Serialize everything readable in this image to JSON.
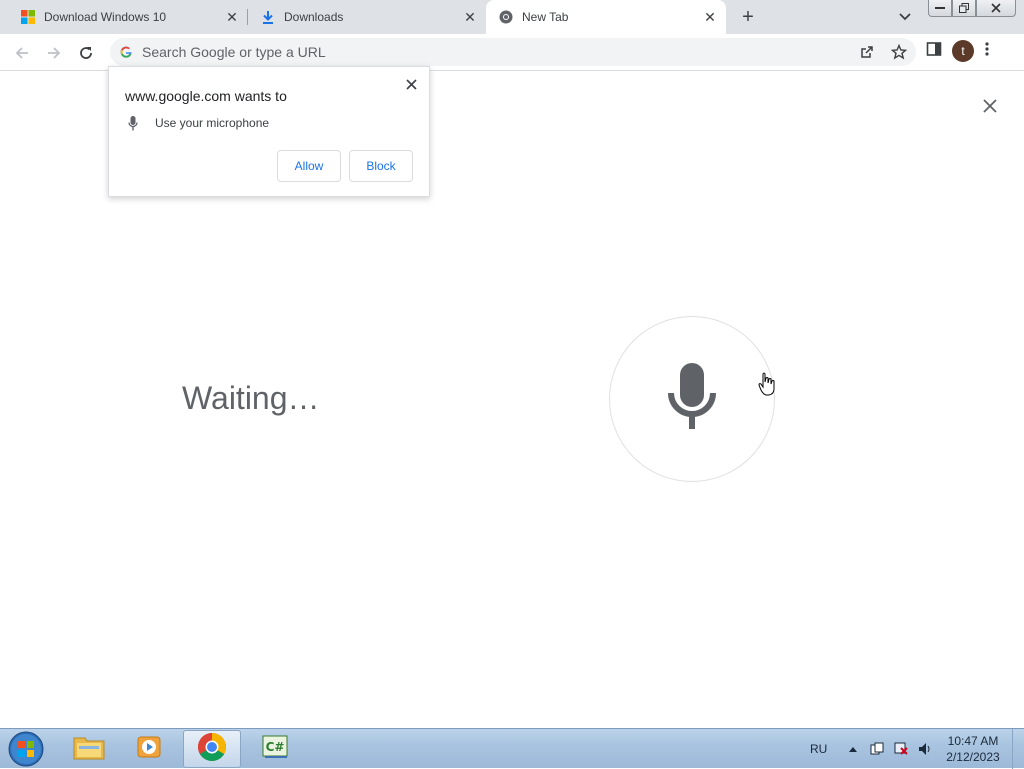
{
  "tabs": [
    {
      "title": "Download Windows 10",
      "icon": "windows-logo-icon"
    },
    {
      "title": "Downloads",
      "icon": "download-icon"
    },
    {
      "title": "New Tab",
      "icon": "chrome-icon",
      "active": true
    }
  ],
  "omnibox": {
    "placeholder": "Search Google or type a URL"
  },
  "profile": {
    "initial": "t"
  },
  "permission_popup": {
    "title": "www.google.com wants to",
    "request": "Use your microphone",
    "allow_label": "Allow",
    "block_label": "Block"
  },
  "voice_search": {
    "status": "Waiting…"
  },
  "taskbar": {
    "language": "RU",
    "time": "10:47 AM",
    "date": "2/12/2023"
  },
  "colors": {
    "accent": "#1a73e8",
    "tabstrip": "#dee1e6",
    "mic": "#5f6368"
  }
}
